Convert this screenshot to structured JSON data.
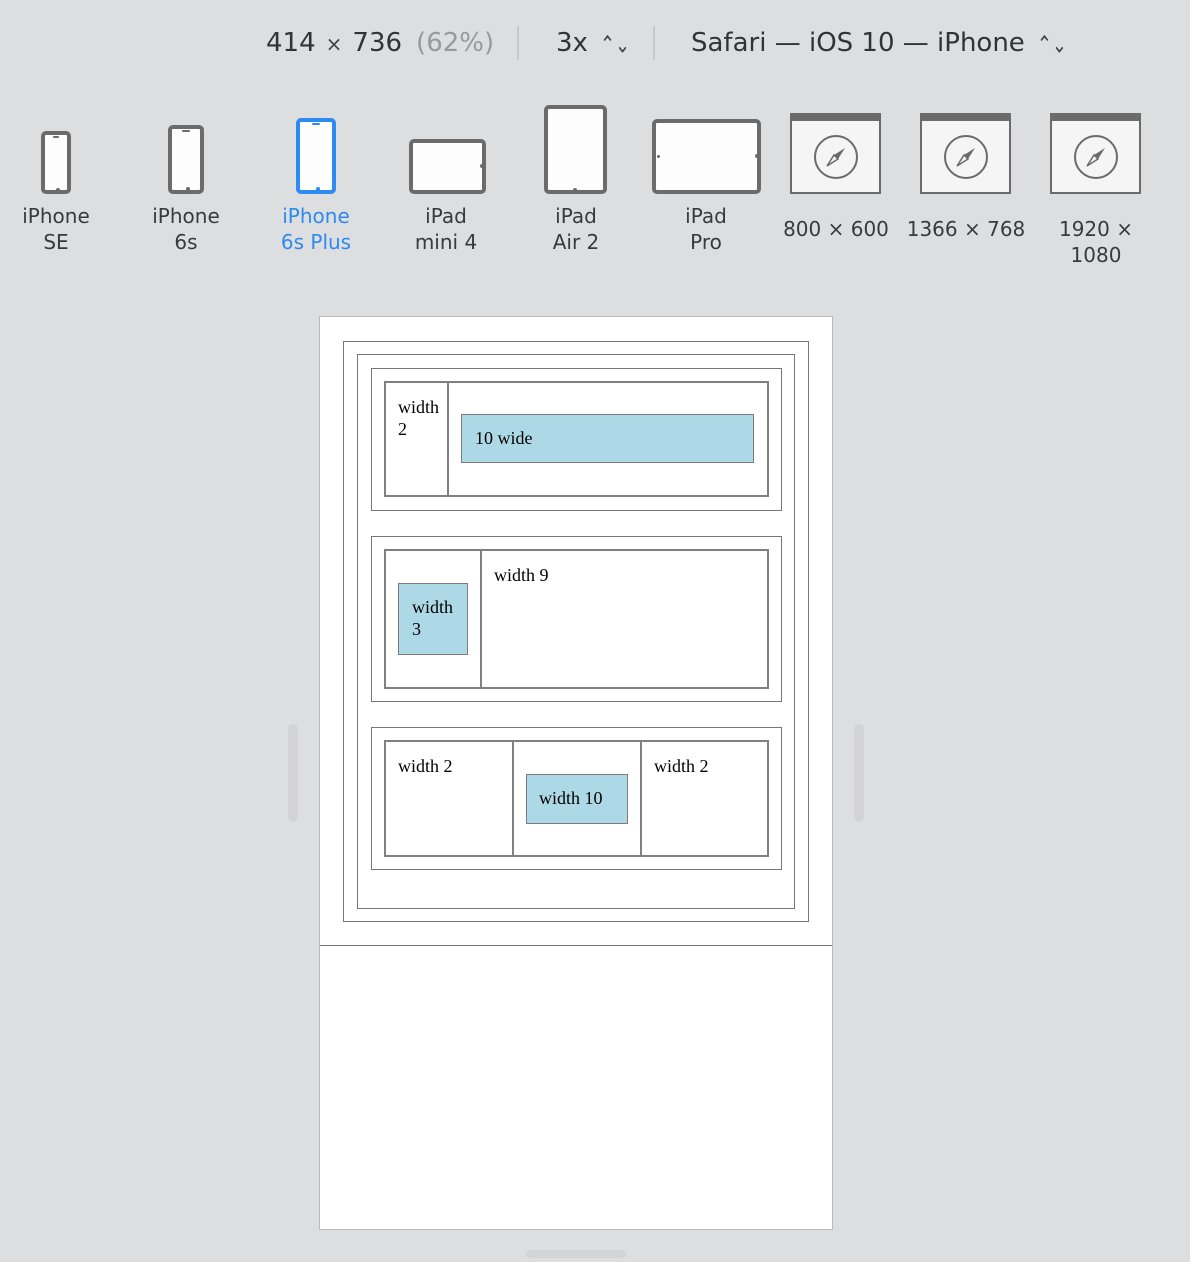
{
  "toolbar": {
    "width": "414",
    "times": "×",
    "height": "736",
    "zoom": "(62%)",
    "scale": "3x",
    "user_agent": "Safari — iOS 10 — iPhone",
    "stepper_icon": "up-down-chevron-icon"
  },
  "devices": [
    {
      "line1": "iPhone",
      "line2": "SE",
      "icon": "iphone-icon",
      "active": false
    },
    {
      "line1": "iPhone",
      "line2": "6s",
      "icon": "iphone-icon",
      "active": false
    },
    {
      "line1": "iPhone",
      "line2": "6s Plus",
      "icon": "iphone-icon",
      "active": true
    },
    {
      "line1": "iPad",
      "line2": "mini 4",
      "icon": "ipad-landscape-icon",
      "active": false
    },
    {
      "line1": "iPad",
      "line2": "Air 2",
      "icon": "ipad-icon",
      "active": false
    },
    {
      "line1": "iPad",
      "line2": "Pro",
      "icon": "ipad-landscape-icon",
      "active": false
    },
    {
      "line1": "800 × 600",
      "icon": "safari-window-icon",
      "active": false
    },
    {
      "line1": "1366 × 768",
      "icon": "safari-window-icon",
      "active": false
    },
    {
      "line1": "1920 × 1080",
      "icon": "safari-window-icon",
      "active": false
    }
  ],
  "page": {
    "row1": {
      "left": "width 2",
      "right_box": "10 wide"
    },
    "row2": {
      "left_box": "width 3",
      "right": "width 9"
    },
    "row3": {
      "left": "width 2",
      "middle_box": "width 10",
      "right": "width 2"
    }
  },
  "colors": {
    "accent": "#2d8af0",
    "box_fill": "#add8e6",
    "background": "#dddee0"
  }
}
